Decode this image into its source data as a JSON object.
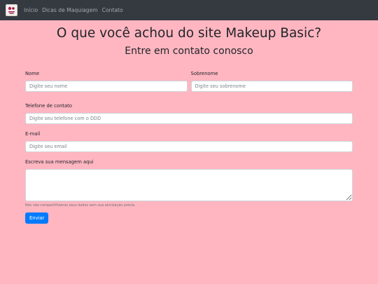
{
  "nav": {
    "logo_icon": "makeup-logo-icon",
    "items": [
      {
        "label": "Início"
      },
      {
        "label": "Dicas de Maquiagem"
      },
      {
        "label": "Contato"
      }
    ]
  },
  "page": {
    "title": "O que você achou do site Makeup Basic?",
    "subtitle": "Entre em contato conosco"
  },
  "form": {
    "first_name": {
      "label": "Nome",
      "placeholder": "Digite seu nome",
      "value": ""
    },
    "last_name": {
      "label": "Sobrenome",
      "placeholder": "Digite seu sobrenome",
      "value": ""
    },
    "phone": {
      "label": "Telefone de contato",
      "placeholder": "Digite seu telefone com o DDD",
      "value": ""
    },
    "email": {
      "label": "E-mail",
      "placeholder": "Digite seu email",
      "value": ""
    },
    "message": {
      "label": "Escreva sua mensagem aqui",
      "value": ""
    },
    "privacy_note": "Nós não compartilhamos seus dados sem sua atorização prévia.",
    "submit_label": "Enviar"
  },
  "colors": {
    "background": "#ffb6c1",
    "navbar": "#343a40",
    "primary_button": "#007bff"
  }
}
